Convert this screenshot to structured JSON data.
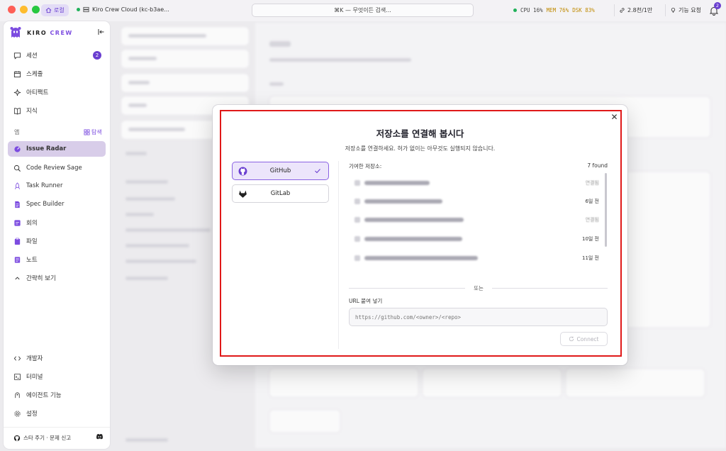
{
  "titlebar": {
    "local_label": "로컬",
    "cloud_label": "Kiro Crew Cloud (kc-b3ae...",
    "search_placeholder": "⌘K — 무엇이든 검색...",
    "cpu": "CPU 16%",
    "mem": "MEM 76%",
    "dsk": "DSK 83%",
    "stars": "2.8천/1만",
    "feature_request": "기능 요청",
    "notifications": "2"
  },
  "sidebar": {
    "brand_kiro": "KIRO",
    "brand_crew": "CREW",
    "top_items": [
      {
        "label": "세션",
        "badge": "2"
      },
      {
        "label": "스케줄"
      },
      {
        "label": "아티팩트"
      },
      {
        "label": "지식"
      }
    ],
    "section_label": "앱",
    "explore_label": "탐색",
    "apps": [
      {
        "label": "Issue Radar"
      },
      {
        "label": "Code Review Sage"
      },
      {
        "label": "Task Runner"
      },
      {
        "label": "Spec Builder"
      },
      {
        "label": "회의"
      },
      {
        "label": "파일"
      },
      {
        "label": "노트"
      },
      {
        "label": "간략히 보기"
      }
    ],
    "bottom_items": [
      {
        "label": "개발자"
      },
      {
        "label": "터미널"
      },
      {
        "label": "에이전트 기능"
      },
      {
        "label": "설정"
      }
    ],
    "footer_text": "스타 주기 · 문제 신고"
  },
  "modal": {
    "title": "저장소를 연결해 봅시다",
    "subtitle": "저장소를 연결하세요. 허가 없이는 아무것도 실행되지 않습니다.",
    "providers": [
      {
        "label": "GitHub",
        "selected": true
      },
      {
        "label": "GitLab",
        "selected": false
      }
    ],
    "recent_label": "기여한 저장소:",
    "found_label": "7 found",
    "repos": [
      {
        "right": "연결됨",
        "faint": true
      },
      {
        "right": "6일 전",
        "faint": false
      },
      {
        "right": "연결됨",
        "faint": true
      },
      {
        "right": "10일 전",
        "faint": false
      },
      {
        "right": "11일 전",
        "faint": false
      }
    ],
    "or_label": "또는",
    "url_label": "URL 붙여 넣기",
    "url_placeholder": "https://github.com/<owner>/<repo>",
    "connect_label": "Connect"
  },
  "colors": {
    "accent": "#7c4ce0",
    "highlight_frame": "#e01919"
  }
}
